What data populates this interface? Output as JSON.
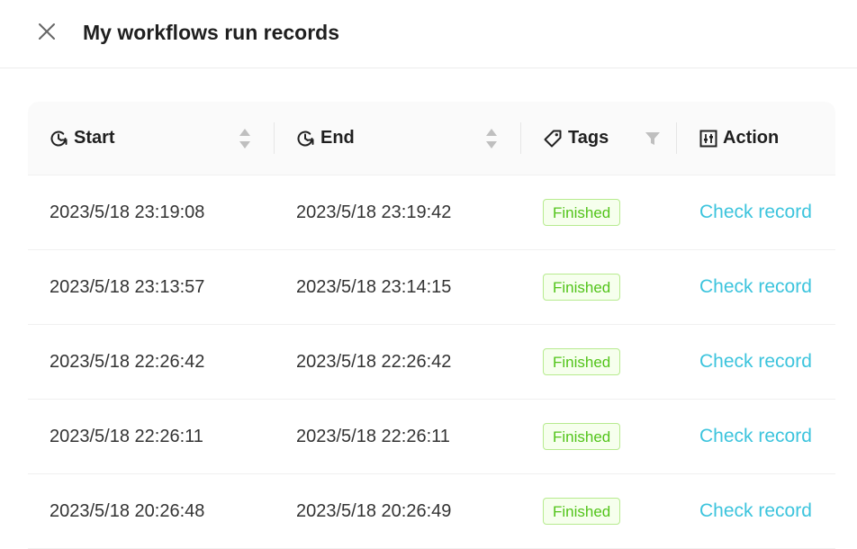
{
  "header": {
    "title": "My workflows run records"
  },
  "table": {
    "columns": {
      "start": "Start",
      "end": "End",
      "tags": "Tags",
      "action": "Action"
    },
    "rows": [
      {
        "start": "2023/5/18 23:19:08",
        "end": "2023/5/18 23:19:42",
        "tag": "Finished",
        "action": "Check record"
      },
      {
        "start": "2023/5/18 23:13:57",
        "end": "2023/5/18 23:14:15",
        "tag": "Finished",
        "action": "Check record"
      },
      {
        "start": "2023/5/18 22:26:42",
        "end": "2023/5/18 22:26:42",
        "tag": "Finished",
        "action": "Check record"
      },
      {
        "start": "2023/5/18 22:26:11",
        "end": "2023/5/18 22:26:11",
        "tag": "Finished",
        "action": "Check record"
      },
      {
        "start": "2023/5/18 20:26:48",
        "end": "2023/5/18 20:26:49",
        "tag": "Finished",
        "action": "Check record"
      }
    ]
  },
  "icons": {
    "close": "close-icon",
    "start": "clock-icon",
    "end": "clock-icon",
    "tags": "tag-icon",
    "action": "sliders-icon",
    "sort": "sort-icon",
    "filter": "filter-icon"
  },
  "colors": {
    "tag_text": "#52c41a",
    "tag_bg": "#f6ffed",
    "tag_border": "#b7eb8f",
    "link": "#3cc4dd"
  }
}
